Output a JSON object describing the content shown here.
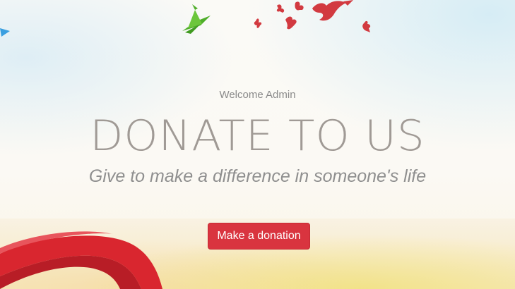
{
  "hero": {
    "welcome_text": "Welcome Admin",
    "title": "DONATE TO US",
    "subtitle": "Give to make a difference in someone's life",
    "button_label": "Make a donation"
  },
  "colors": {
    "button": "#d9343f",
    "title": "#a09a95",
    "birds": "#d23a40",
    "crane": "#5ab82e",
    "ribbon": "#d9262f"
  },
  "icons": [
    "origami-crane-icon",
    "red-bird-icon",
    "red-ribbon-decoration"
  ]
}
